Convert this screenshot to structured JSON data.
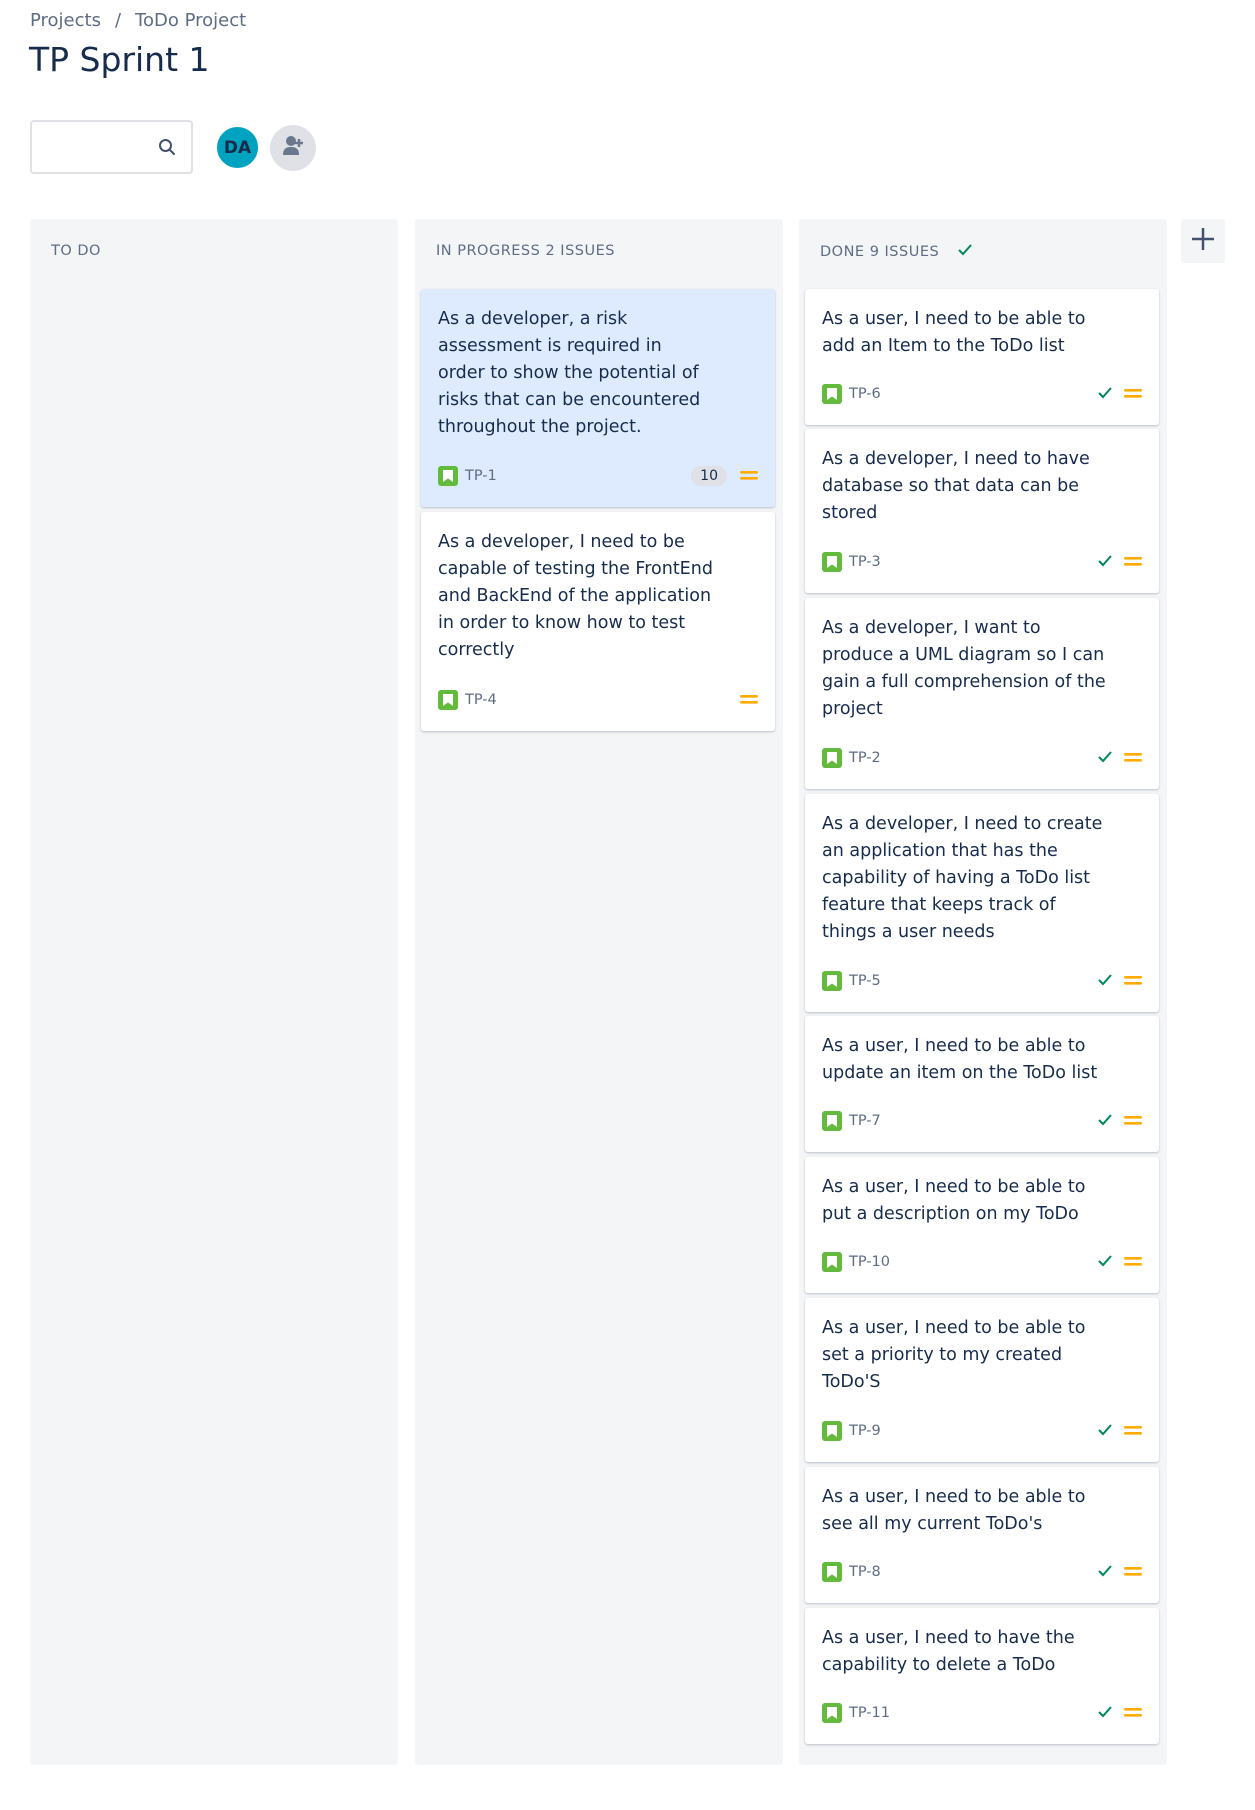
{
  "breadcrumb": {
    "projects": "Projects",
    "separator": "/",
    "project": "ToDo Project"
  },
  "title": "TP Sprint 1",
  "toolbar": {
    "search_placeholder": "",
    "avatar_initials": "DA"
  },
  "columns": [
    {
      "id": "todo",
      "header": "TO DO",
      "cards": []
    },
    {
      "id": "progress",
      "header": "IN PROGRESS 2 ISSUES",
      "cards": [
        {
          "summary": "As a developer, a risk assessment is required in order to show the potential of risks that can be encountered throughout the project.",
          "key": "TP-1",
          "points": "10",
          "selected": true
        },
        {
          "summary": "As a developer, I need to be capable of testing the FrontEnd and BackEnd of the application in order to know how to test correctly",
          "key": "TP-4"
        }
      ]
    },
    {
      "id": "done",
      "header": "DONE 9 ISSUES",
      "cards": [
        {
          "summary": "As a user, I need to be able to add an Item to the ToDo list",
          "key": "TP-6"
        },
        {
          "summary": "As a developer, I need to have database so that data can be stored",
          "key": "TP-3"
        },
        {
          "summary": "As a developer, I want to produce a UML diagram so I can gain a full comprehension of the project",
          "key": "TP-2"
        },
        {
          "summary": "As a developer, I need to create an application that has the capability of having a ToDo list feature that keeps track of things a user needs",
          "key": "TP-5"
        },
        {
          "summary": "As a user, I need to be able to update an item on the ToDo list",
          "key": "TP-7"
        },
        {
          "summary": "As a user, I need to be able to put a description on my ToDo",
          "key": "TP-10"
        },
        {
          "summary": "As a user, I need to be able to set a priority to my created ToDo'S",
          "key": "TP-9"
        },
        {
          "summary": "As a user, I need to be able to see all my current ToDo's",
          "key": "TP-8"
        },
        {
          "summary": "As a user, I need to have the capability to delete a ToDo",
          "key": "TP-11"
        }
      ]
    }
  ],
  "icons": {
    "story": "story-bookmark-icon",
    "priority": "priority-medium-icon",
    "done": "done-check-icon",
    "search": "search-icon",
    "add_people": "add-people-icon",
    "add_column": "plus-icon"
  },
  "colors": {
    "story": "#63ba3c",
    "priority": "#ffab00",
    "check": "#00875a",
    "avatar": "#00a3bf",
    "selected_card": "#deebff"
  }
}
